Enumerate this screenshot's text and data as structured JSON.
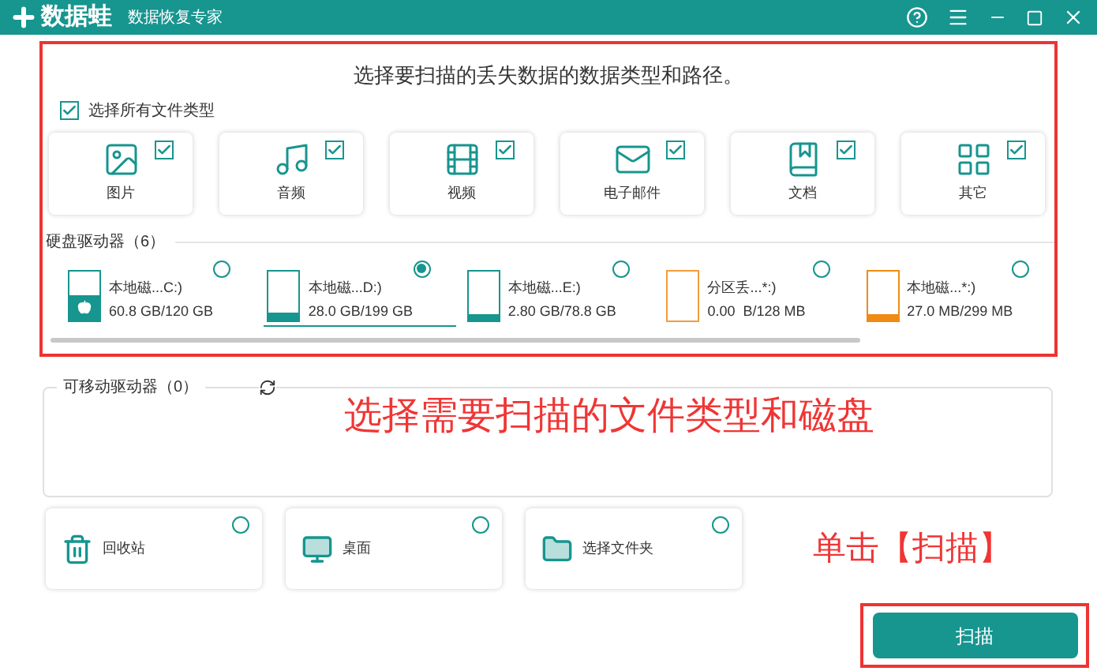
{
  "window": {
    "app_name": "数据蛙",
    "subtitle": "数据恢复专家"
  },
  "heading": "选择要扫描的丢失数据的数据类型和路径。",
  "select_all": {
    "label": "选择所有文件类型",
    "checked": true
  },
  "file_types": [
    {
      "kind": "image",
      "label": "图片",
      "checked": true
    },
    {
      "kind": "audio",
      "label": "音频",
      "checked": true
    },
    {
      "kind": "video",
      "label": "视频",
      "checked": true
    },
    {
      "kind": "email",
      "label": "电子邮件",
      "checked": true
    },
    {
      "kind": "document",
      "label": "文档",
      "checked": true
    },
    {
      "kind": "other",
      "label": "其它",
      "checked": true
    }
  ],
  "hard_drives": {
    "title": "硬盘驱动器（6）",
    "drives": [
      {
        "name": "本地磁...C:)",
        "size": "60.8 GB/120 GB",
        "level": 0.5,
        "color": "#17958f",
        "system": true,
        "selected": false
      },
      {
        "name": "本地磁...D:)",
        "size": "28.0 GB/199 GB",
        "level": 0.14,
        "color": "#17958f",
        "system": false,
        "selected": true
      },
      {
        "name": "本地磁...E:)",
        "size": "2.80 GB/78.8 GB",
        "level": 0.04,
        "color": "#17958f",
        "system": false,
        "selected": false
      },
      {
        "name": "分区丢...*:)",
        "size": "0.00  B/128 MB",
        "level": 0,
        "color": "#f39c3c",
        "system": false,
        "selected": false
      },
      {
        "name": "本地磁...*:)",
        "size": "27.0 MB/299 MB",
        "level": 0.09,
        "color": "#f08a12",
        "system": false,
        "selected": false
      }
    ]
  },
  "removable_drives": {
    "title": "可移动驱动器（0）"
  },
  "locations": [
    {
      "kind": "recycle",
      "label": "回收站",
      "selected": false
    },
    {
      "kind": "desktop",
      "label": "桌面",
      "selected": false
    },
    {
      "kind": "folder",
      "label": "选择文件夹",
      "selected": false
    }
  ],
  "annotations": [
    "选择需要扫描的文件类型和磁盘",
    "单击【扫描】"
  ],
  "scan_button": "扫描"
}
